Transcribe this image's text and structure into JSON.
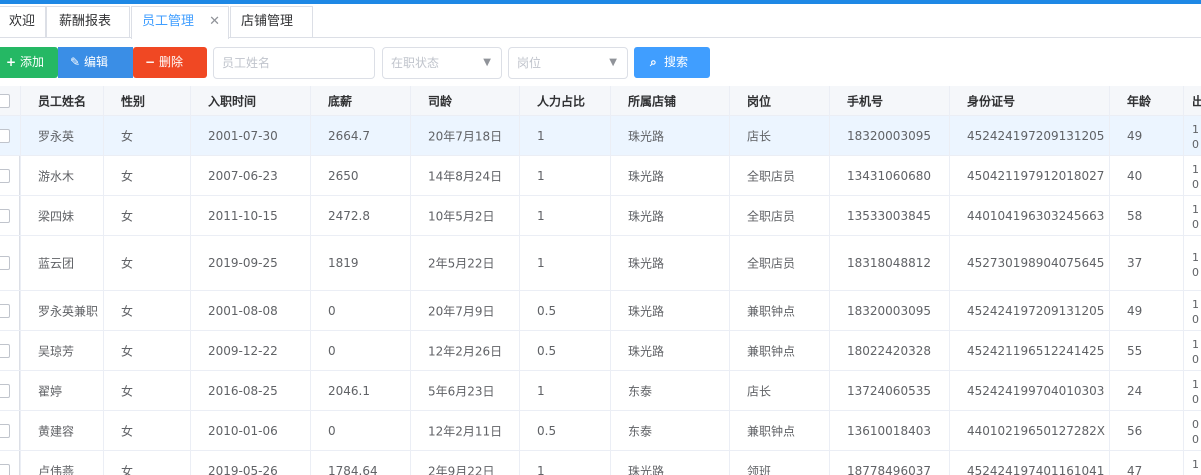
{
  "tabs": [
    {
      "label": "欢迎"
    },
    {
      "label": "薪酬报表"
    },
    {
      "label": "员工管理",
      "close": "✕"
    },
    {
      "label": "店铺管理"
    }
  ],
  "toolbar": {
    "add_label": "添加",
    "edit_label": "编辑",
    "delete_label": "删除",
    "search_label": "搜索",
    "name_placeholder": "员工姓名",
    "status_placeholder": "在职状态",
    "position_placeholder": "岗位"
  },
  "table": {
    "columns": [
      "员工姓名",
      "性别",
      "入职时间",
      "底薪",
      "司龄",
      "人力占比",
      "所属店铺",
      "岗位",
      "手机号",
      "身份证号",
      "年龄",
      "出"
    ],
    "rows": [
      [
        "罗永英",
        "女",
        "2001-07-30",
        "2664.7",
        "20年7月18日",
        "1",
        "珠光路",
        "店长",
        "18320003095",
        "452424197209131205",
        "49"
      ],
      [
        "游水木",
        "女",
        "2007-06-23",
        "2650",
        "14年8月24日",
        "1",
        "珠光路",
        "全职店员",
        "13431060680",
        "450421197912018027",
        "40"
      ],
      [
        "梁四妹",
        "女",
        "2011-10-15",
        "2472.8",
        "10年5月2日",
        "1",
        "珠光路",
        "全职店员",
        "13533003845",
        "440104196303245663",
        "58"
      ],
      [
        "蓝云团",
        "女",
        "2019-09-25",
        "1819",
        "2年5月22日",
        "1",
        "珠光路",
        "全职店员",
        "18318048812",
        "452730198904075645",
        "37"
      ],
      [
        "罗永英兼职",
        "女",
        "2001-08-08",
        "0",
        "20年7月9日",
        "0.5",
        "珠光路",
        "兼职钟点",
        "18320003095",
        "452424197209131205",
        "49"
      ],
      [
        "吴琼芳",
        "女",
        "2009-12-22",
        "0",
        "12年2月26日",
        "0.5",
        "珠光路",
        "兼职钟点",
        "18022420328",
        "452421196512241425",
        "55"
      ],
      [
        "翟婷",
        "女",
        "2016-08-25",
        "2046.1",
        "5年6月23日",
        "1",
        "东泰",
        "店长",
        "13724060535",
        "452424199704010303",
        "24"
      ],
      [
        "黄建容",
        "女",
        "2010-01-06",
        "0",
        "12年2月11日",
        "0.5",
        "东泰",
        "兼职钟点",
        "13610018403",
        "44010219650127282X",
        "56"
      ],
      [
        "卢伟燕",
        "女",
        "2019-05-26",
        "1784.64",
        "2年9月22日",
        "1",
        "珠光路",
        "领班",
        "18778496037",
        "452424197401161041",
        "47"
      ]
    ],
    "tail_fragments": [
      [
        "1",
        "0"
      ],
      [
        "1",
        "0"
      ],
      [
        "1",
        "0"
      ],
      [
        "1",
        "0"
      ],
      [
        "1",
        "0"
      ],
      [
        "1",
        "0"
      ],
      [
        "1",
        "0"
      ],
      [
        "0",
        "0"
      ],
      [
        "1",
        ""
      ]
    ]
  }
}
